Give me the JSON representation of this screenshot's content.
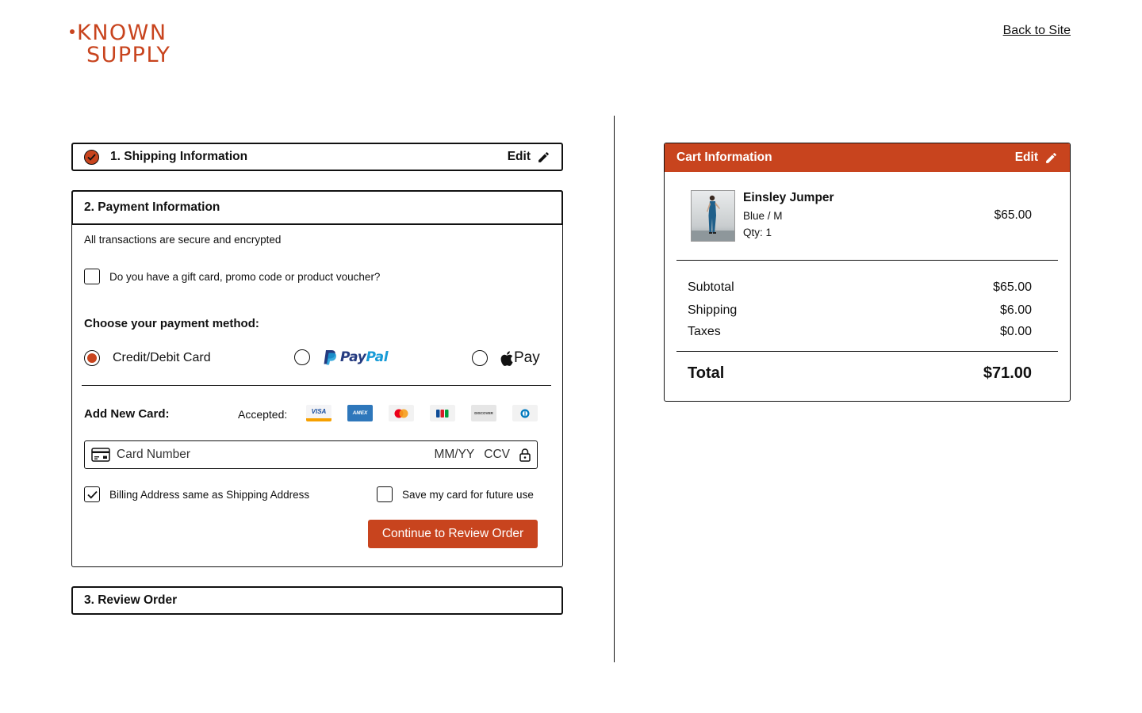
{
  "brand": {
    "line1": "KNOWN",
    "line2": "SUPPLY",
    "color": "#c8441e"
  },
  "header": {
    "back_link": "Back to Site"
  },
  "steps": {
    "shipping": {
      "title": "1. Shipping Information",
      "edit_label": "Edit",
      "completed": true
    },
    "payment": {
      "title": "2. Payment Information",
      "secure_note": "All transactions are secure and encrypted",
      "gift_card_label": "Do you have a gift card, promo code or product voucher?",
      "gift_card_checked": false,
      "choose_label": "Choose your payment method:",
      "methods": [
        {
          "label": "Credit/Debit Card",
          "selected": true
        },
        {
          "label": "PayPal",
          "selected": false
        },
        {
          "label": "Pay",
          "selected": false
        }
      ],
      "add_card_label": "Add New Card:",
      "accepted_label": "Accepted:",
      "card_logos": [
        "visa-icon",
        "amex-icon",
        "mastercard-icon",
        "jcb-icon",
        "discover-icon",
        "diners-icon"
      ],
      "card_logo_text": {
        "visa": "VISA",
        "amex": "AMEX",
        "discover": "DISCOVER"
      },
      "card_number_placeholder": "Card Number",
      "expiry_placeholder": "MM/YY",
      "ccv_placeholder": "CCV",
      "billing_same_label": "Billing Address same as Shipping Address",
      "billing_same_checked": true,
      "save_card_label": "Save my card for future use",
      "save_card_checked": false,
      "continue_label": "Continue to Review Order"
    },
    "review": {
      "title": "3. Review Order"
    }
  },
  "cart": {
    "title": "Cart Information",
    "edit_label": "Edit",
    "items": [
      {
        "name": "Einsley Jumper",
        "variant": "Blue / M",
        "qty": "Qty: 1",
        "price": "$65.00"
      }
    ],
    "subtotal_label": "Subtotal",
    "subtotal": "$65.00",
    "shipping_label": "Shipping",
    "shipping": "$6.00",
    "taxes_label": "Taxes",
    "taxes": "$0.00",
    "total_label": "Total",
    "total": "$71.00"
  },
  "colors": {
    "accent": "#c8441e",
    "paypal_dark": "#253b80",
    "paypal_light": "#179bd7"
  }
}
